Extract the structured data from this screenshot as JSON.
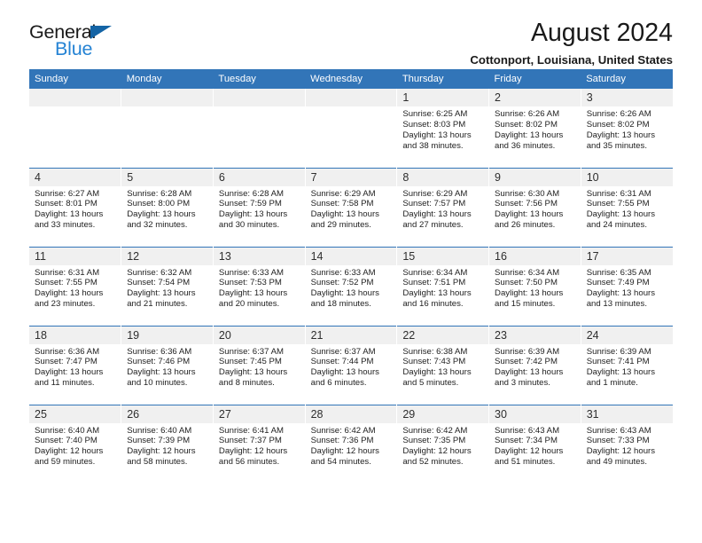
{
  "brand": {
    "line1": "General",
    "line2": "Blue",
    "triangle_color": "#1464a5",
    "blue_color": "#2583d4"
  },
  "header": {
    "title": "August 2024",
    "subtitle": "Cottonport, Louisiana, United States"
  },
  "theme": {
    "header_bg": "#3275b8",
    "daynum_bg": "#f0f0f0",
    "row_divider": "#3275b8"
  },
  "weekdays": [
    "Sunday",
    "Monday",
    "Tuesday",
    "Wednesday",
    "Thursday",
    "Friday",
    "Saturday"
  ],
  "weeks": [
    [
      {
        "day": "",
        "sunrise": "",
        "sunset": "",
        "daylight1": "",
        "daylight2": ""
      },
      {
        "day": "",
        "sunrise": "",
        "sunset": "",
        "daylight1": "",
        "daylight2": ""
      },
      {
        "day": "",
        "sunrise": "",
        "sunset": "",
        "daylight1": "",
        "daylight2": ""
      },
      {
        "day": "",
        "sunrise": "",
        "sunset": "",
        "daylight1": "",
        "daylight2": ""
      },
      {
        "day": "1",
        "sunrise": "Sunrise: 6:25 AM",
        "sunset": "Sunset: 8:03 PM",
        "daylight1": "Daylight: 13 hours",
        "daylight2": "and 38 minutes."
      },
      {
        "day": "2",
        "sunrise": "Sunrise: 6:26 AM",
        "sunset": "Sunset: 8:02 PM",
        "daylight1": "Daylight: 13 hours",
        "daylight2": "and 36 minutes."
      },
      {
        "day": "3",
        "sunrise": "Sunrise: 6:26 AM",
        "sunset": "Sunset: 8:02 PM",
        "daylight1": "Daylight: 13 hours",
        "daylight2": "and 35 minutes."
      }
    ],
    [
      {
        "day": "4",
        "sunrise": "Sunrise: 6:27 AM",
        "sunset": "Sunset: 8:01 PM",
        "daylight1": "Daylight: 13 hours",
        "daylight2": "and 33 minutes."
      },
      {
        "day": "5",
        "sunrise": "Sunrise: 6:28 AM",
        "sunset": "Sunset: 8:00 PM",
        "daylight1": "Daylight: 13 hours",
        "daylight2": "and 32 minutes."
      },
      {
        "day": "6",
        "sunrise": "Sunrise: 6:28 AM",
        "sunset": "Sunset: 7:59 PM",
        "daylight1": "Daylight: 13 hours",
        "daylight2": "and 30 minutes."
      },
      {
        "day": "7",
        "sunrise": "Sunrise: 6:29 AM",
        "sunset": "Sunset: 7:58 PM",
        "daylight1": "Daylight: 13 hours",
        "daylight2": "and 29 minutes."
      },
      {
        "day": "8",
        "sunrise": "Sunrise: 6:29 AM",
        "sunset": "Sunset: 7:57 PM",
        "daylight1": "Daylight: 13 hours",
        "daylight2": "and 27 minutes."
      },
      {
        "day": "9",
        "sunrise": "Sunrise: 6:30 AM",
        "sunset": "Sunset: 7:56 PM",
        "daylight1": "Daylight: 13 hours",
        "daylight2": "and 26 minutes."
      },
      {
        "day": "10",
        "sunrise": "Sunrise: 6:31 AM",
        "sunset": "Sunset: 7:55 PM",
        "daylight1": "Daylight: 13 hours",
        "daylight2": "and 24 minutes."
      }
    ],
    [
      {
        "day": "11",
        "sunrise": "Sunrise: 6:31 AM",
        "sunset": "Sunset: 7:55 PM",
        "daylight1": "Daylight: 13 hours",
        "daylight2": "and 23 minutes."
      },
      {
        "day": "12",
        "sunrise": "Sunrise: 6:32 AM",
        "sunset": "Sunset: 7:54 PM",
        "daylight1": "Daylight: 13 hours",
        "daylight2": "and 21 minutes."
      },
      {
        "day": "13",
        "sunrise": "Sunrise: 6:33 AM",
        "sunset": "Sunset: 7:53 PM",
        "daylight1": "Daylight: 13 hours",
        "daylight2": "and 20 minutes."
      },
      {
        "day": "14",
        "sunrise": "Sunrise: 6:33 AM",
        "sunset": "Sunset: 7:52 PM",
        "daylight1": "Daylight: 13 hours",
        "daylight2": "and 18 minutes."
      },
      {
        "day": "15",
        "sunrise": "Sunrise: 6:34 AM",
        "sunset": "Sunset: 7:51 PM",
        "daylight1": "Daylight: 13 hours",
        "daylight2": "and 16 minutes."
      },
      {
        "day": "16",
        "sunrise": "Sunrise: 6:34 AM",
        "sunset": "Sunset: 7:50 PM",
        "daylight1": "Daylight: 13 hours",
        "daylight2": "and 15 minutes."
      },
      {
        "day": "17",
        "sunrise": "Sunrise: 6:35 AM",
        "sunset": "Sunset: 7:49 PM",
        "daylight1": "Daylight: 13 hours",
        "daylight2": "and 13 minutes."
      }
    ],
    [
      {
        "day": "18",
        "sunrise": "Sunrise: 6:36 AM",
        "sunset": "Sunset: 7:47 PM",
        "daylight1": "Daylight: 13 hours",
        "daylight2": "and 11 minutes."
      },
      {
        "day": "19",
        "sunrise": "Sunrise: 6:36 AM",
        "sunset": "Sunset: 7:46 PM",
        "daylight1": "Daylight: 13 hours",
        "daylight2": "and 10 minutes."
      },
      {
        "day": "20",
        "sunrise": "Sunrise: 6:37 AM",
        "sunset": "Sunset: 7:45 PM",
        "daylight1": "Daylight: 13 hours",
        "daylight2": "and 8 minutes."
      },
      {
        "day": "21",
        "sunrise": "Sunrise: 6:37 AM",
        "sunset": "Sunset: 7:44 PM",
        "daylight1": "Daylight: 13 hours",
        "daylight2": "and 6 minutes."
      },
      {
        "day": "22",
        "sunrise": "Sunrise: 6:38 AM",
        "sunset": "Sunset: 7:43 PM",
        "daylight1": "Daylight: 13 hours",
        "daylight2": "and 5 minutes."
      },
      {
        "day": "23",
        "sunrise": "Sunrise: 6:39 AM",
        "sunset": "Sunset: 7:42 PM",
        "daylight1": "Daylight: 13 hours",
        "daylight2": "and 3 minutes."
      },
      {
        "day": "24",
        "sunrise": "Sunrise: 6:39 AM",
        "sunset": "Sunset: 7:41 PM",
        "daylight1": "Daylight: 13 hours",
        "daylight2": "and 1 minute."
      }
    ],
    [
      {
        "day": "25",
        "sunrise": "Sunrise: 6:40 AM",
        "sunset": "Sunset: 7:40 PM",
        "daylight1": "Daylight: 12 hours",
        "daylight2": "and 59 minutes."
      },
      {
        "day": "26",
        "sunrise": "Sunrise: 6:40 AM",
        "sunset": "Sunset: 7:39 PM",
        "daylight1": "Daylight: 12 hours",
        "daylight2": "and 58 minutes."
      },
      {
        "day": "27",
        "sunrise": "Sunrise: 6:41 AM",
        "sunset": "Sunset: 7:37 PM",
        "daylight1": "Daylight: 12 hours",
        "daylight2": "and 56 minutes."
      },
      {
        "day": "28",
        "sunrise": "Sunrise: 6:42 AM",
        "sunset": "Sunset: 7:36 PM",
        "daylight1": "Daylight: 12 hours",
        "daylight2": "and 54 minutes."
      },
      {
        "day": "29",
        "sunrise": "Sunrise: 6:42 AM",
        "sunset": "Sunset: 7:35 PM",
        "daylight1": "Daylight: 12 hours",
        "daylight2": "and 52 minutes."
      },
      {
        "day": "30",
        "sunrise": "Sunrise: 6:43 AM",
        "sunset": "Sunset: 7:34 PM",
        "daylight1": "Daylight: 12 hours",
        "daylight2": "and 51 minutes."
      },
      {
        "day": "31",
        "sunrise": "Sunrise: 6:43 AM",
        "sunset": "Sunset: 7:33 PM",
        "daylight1": "Daylight: 12 hours",
        "daylight2": "and 49 minutes."
      }
    ]
  ]
}
